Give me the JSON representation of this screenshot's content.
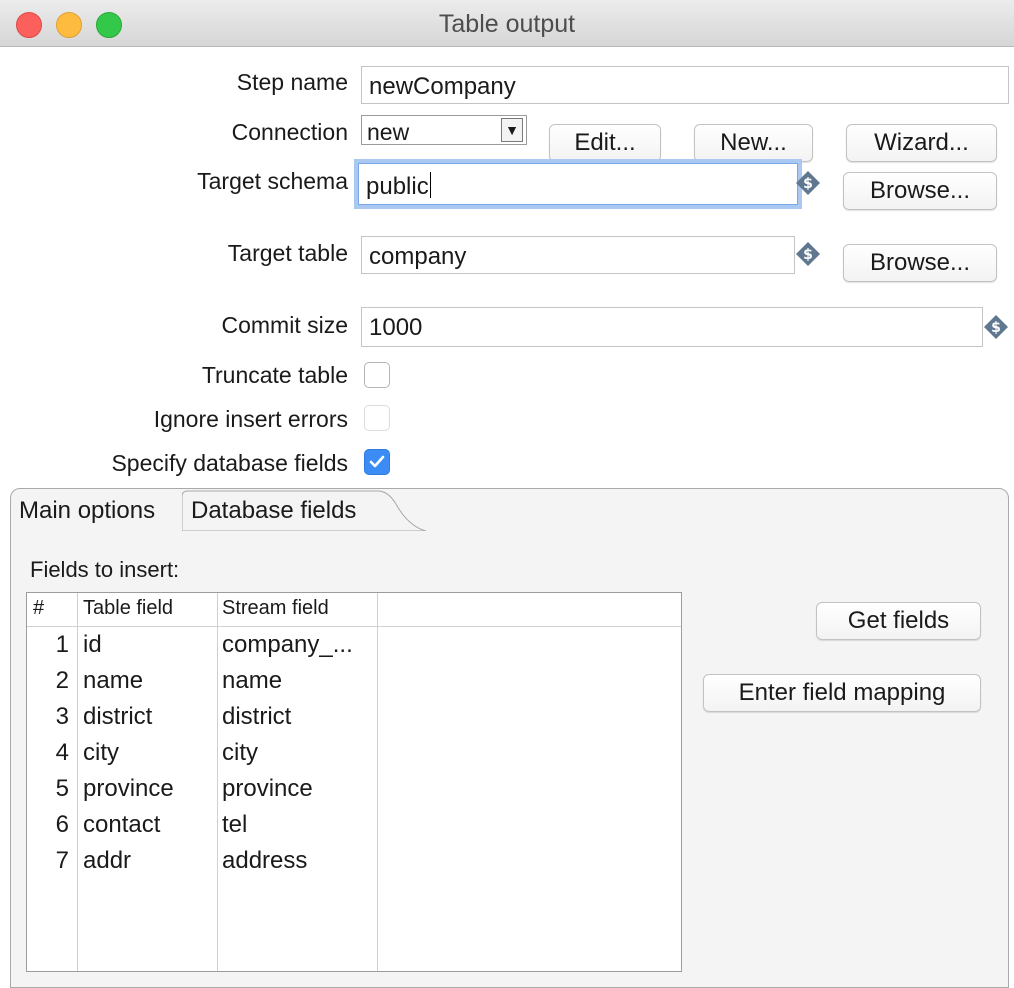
{
  "window": {
    "title": "Table output"
  },
  "form": {
    "step_name": {
      "label": "Step name",
      "value": "newCompany"
    },
    "connection": {
      "label": "Connection",
      "value": "new",
      "edit_label": "Edit...",
      "new_label": "New...",
      "wizard_label": "Wizard..."
    },
    "target_schema": {
      "label": "Target schema",
      "value": "public",
      "browse_label": "Browse..."
    },
    "target_table": {
      "label": "Target table",
      "value": "company",
      "browse_label": "Browse..."
    },
    "commit_size": {
      "label": "Commit size",
      "value": "1000"
    },
    "truncate_table": {
      "label": "Truncate table",
      "checked": false
    },
    "ignore_insert_errors": {
      "label": "Ignore insert errors",
      "checked": false,
      "disabled": true
    },
    "specify_database_fields": {
      "label": "Specify database fields",
      "checked": true
    }
  },
  "tabs": [
    {
      "label": "Main options",
      "active": false
    },
    {
      "label": "Database fields",
      "active": true
    }
  ],
  "database_fields": {
    "section_label": "Fields to insert:",
    "columns": [
      "#",
      "Table field",
      "Stream field"
    ],
    "rows": [
      {
        "num": "1",
        "table_field": "id",
        "stream_field": "company_..."
      },
      {
        "num": "2",
        "table_field": "name",
        "stream_field": "name"
      },
      {
        "num": "3",
        "table_field": "district",
        "stream_field": "district"
      },
      {
        "num": "4",
        "table_field": "city",
        "stream_field": "city"
      },
      {
        "num": "5",
        "table_field": "province",
        "stream_field": "province"
      },
      {
        "num": "6",
        "table_field": "contact",
        "stream_field": "tel"
      },
      {
        "num": "7",
        "table_field": "addr",
        "stream_field": "address"
      }
    ],
    "get_fields_label": "Get fields",
    "enter_field_mapping_label": "Enter field mapping"
  },
  "colors": {
    "accent": "#3b8df5",
    "focus_ring": "#a9c8f2",
    "variable_icon": "#5f7890"
  },
  "icons": {
    "variable": "variable-dollar-icon",
    "checkmark": "checkmark-icon",
    "dropdown": "dropdown-arrow-icon"
  }
}
